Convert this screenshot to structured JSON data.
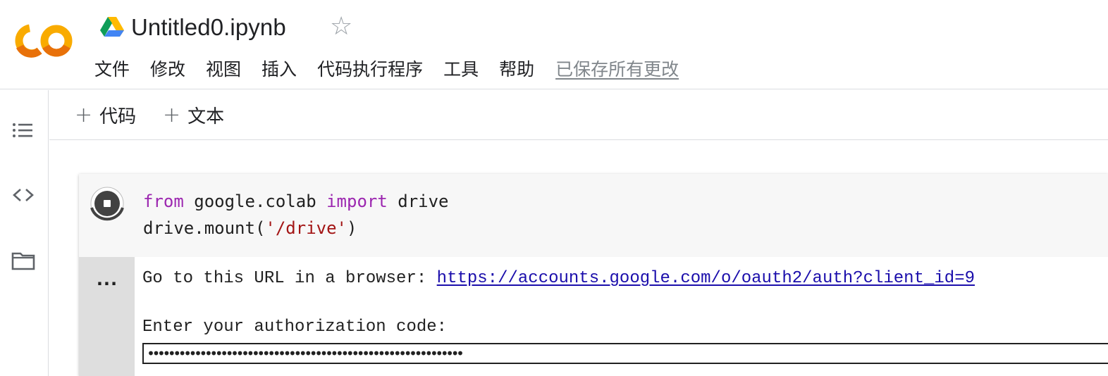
{
  "header": {
    "title": "Untitled0.ipynb",
    "star_icon": "star-outline-icon",
    "menu": [
      "文件",
      "修改",
      "视图",
      "插入",
      "代码执行程序",
      "工具",
      "帮助"
    ],
    "save_status": "已保存所有更改"
  },
  "toolbar": {
    "add_code_label": "代码",
    "add_text_label": "文本",
    "plus_glyph": "+"
  },
  "rail": {
    "icons": [
      "toc-icon",
      "code-snippets-icon",
      "files-folder-icon"
    ]
  },
  "cell": {
    "code": {
      "line1": {
        "kw1": "from",
        "mod": " google.colab ",
        "kw2": "import",
        "name": " drive"
      },
      "line2": {
        "pre": "drive.mount(",
        "str": "'/drive'",
        "post": ")"
      }
    },
    "output": {
      "menu_glyph": "...",
      "url_prompt": "Go to this URL in a browser: ",
      "url": "https://accounts.google.com/o/oauth2/auth?client_id=9",
      "code_prompt": "Enter your authorization code:",
      "code_value": "••••••••••••••••••••••••••••••••••••••••••••••••••••••••••••"
    }
  },
  "colors": {
    "keyword": "#9c27b0",
    "string": "#a31515",
    "link": "#1a0dab",
    "logo_orange": "#f9ab00",
    "logo_dark_orange": "#e8710a"
  }
}
